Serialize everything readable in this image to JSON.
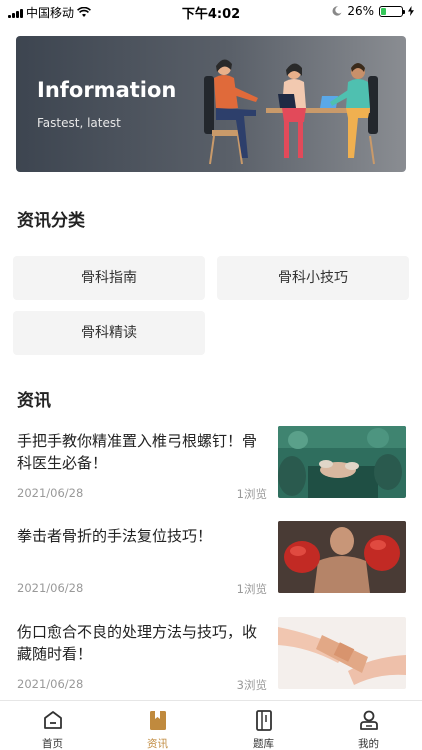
{
  "status_bar": {
    "carrier": "中国移动",
    "time": "下午4:02",
    "battery": "26%",
    "battery_level": 0.26,
    "icons": [
      "signal-icon",
      "wifi-icon",
      "moon-icon",
      "battery-icon",
      "charging-icon"
    ]
  },
  "banner": {
    "title": "Information",
    "subtitle": "Fastest, latest"
  },
  "categories": {
    "heading": "资讯分类",
    "items": [
      {
        "label": "骨科指南"
      },
      {
        "label": "骨科小技巧"
      },
      {
        "label": "骨科精读"
      }
    ]
  },
  "news": {
    "heading": "资讯",
    "articles": [
      {
        "title": "手把手教你精准置入椎弓根螺钉！骨科医生必备！",
        "date": "2021/06/28",
        "views": "1浏览",
        "image": "surgery-photo"
      },
      {
        "title": "拳击者骨折的手法复位技巧！",
        "date": "2021/06/28",
        "views": "1浏览",
        "image": "boxer-photo"
      },
      {
        "title": "伤口愈合不良的处理方法与技巧，收藏随时看！",
        "date": "2021/06/28",
        "views": "3浏览",
        "image": "bandage-photo"
      }
    ]
  },
  "tab_bar": {
    "active": "资讯",
    "active_color": "#c08a3e",
    "tabs": [
      {
        "label": "首页",
        "icon": "home-icon"
      },
      {
        "label": "资讯",
        "icon": "news-icon"
      },
      {
        "label": "题库",
        "icon": "question-bank-icon"
      },
      {
        "label": "我的",
        "icon": "profile-icon"
      }
    ]
  }
}
